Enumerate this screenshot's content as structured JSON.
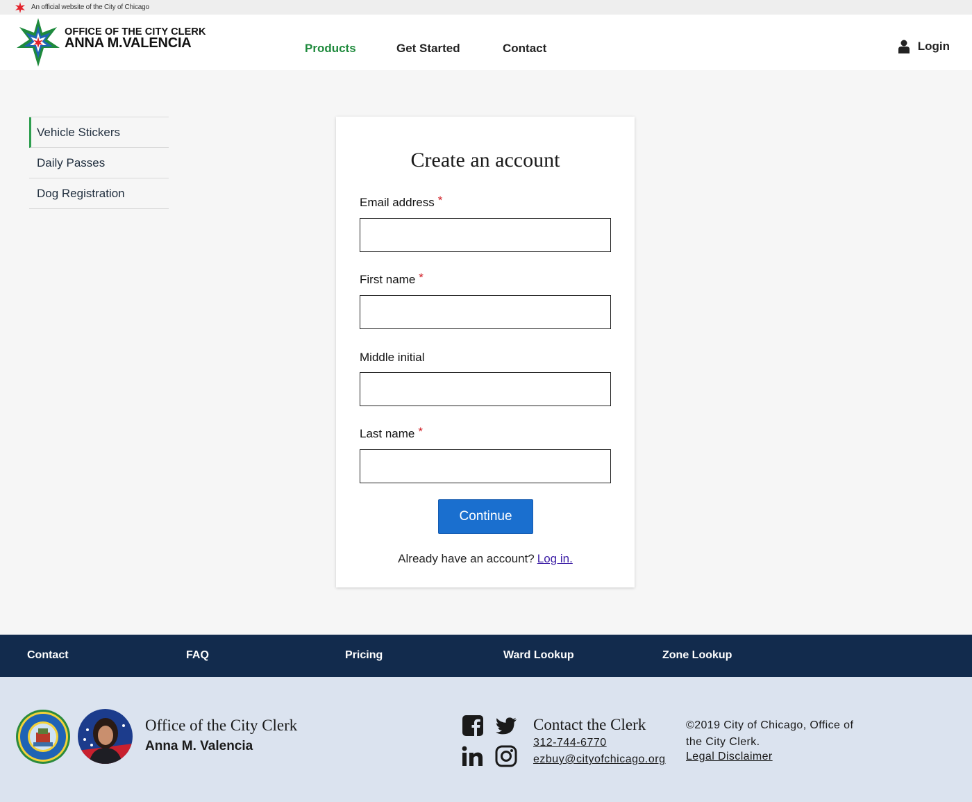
{
  "official_bar": {
    "text": "An official website of the City of Chicago"
  },
  "header": {
    "logo_line1": "OFFICE OF THE CITY CLERK",
    "logo_line2": "ANNA M.VALENCIA",
    "nav": [
      "Products",
      "Get Started",
      "Contact"
    ],
    "login_label": "Login"
  },
  "sidebar": {
    "items": [
      {
        "label": "Vehicle Stickers",
        "active": true
      },
      {
        "label": "Daily Passes",
        "active": false
      },
      {
        "label": "Dog Registration",
        "active": false
      }
    ]
  },
  "form": {
    "title": "Create an account",
    "required_mark": "*",
    "fields": [
      {
        "label": "Email address",
        "required": true,
        "value": ""
      },
      {
        "label": "First name",
        "required": true,
        "value": ""
      },
      {
        "label": "Middle initial",
        "required": false,
        "value": ""
      },
      {
        "label": "Last name",
        "required": true,
        "value": ""
      }
    ],
    "continue_label": "Continue",
    "already_text": "Already have an account?",
    "login_link": "Log in."
  },
  "footer_nav": [
    "Contact",
    "FAQ",
    "Pricing",
    "Ward Lookup",
    "Zone Lookup"
  ],
  "footer": {
    "office": "Office of the City Clerk",
    "name": "Anna M. Valencia",
    "contact_title": "Contact the Clerk",
    "phone": "312-744-6770",
    "email": "ezbuy@cityofchicago.org",
    "copyright": "©2019 City of Chicago, Office of the City Clerk.",
    "legal": "Legal Disclaimer",
    "seal_text_top": "CITY OF CHICAGO",
    "seal_text_bottom": "INCORPORATED 4th MARCH 1837"
  },
  "icons": {
    "official": "chicago-star-icon",
    "login": "user-icon",
    "social": [
      "facebook-icon",
      "twitter-icon",
      "linkedin-icon",
      "instagram-icon"
    ]
  },
  "colors": {
    "nav_active": "#1e8a3c",
    "sidebar_active": "#2e9e4f",
    "button": "#1a6fcf",
    "footer_nav_bg": "#122b4d",
    "footer_bg": "#dbe3ef",
    "required": "#d01f26",
    "link": "#3d1fa6"
  }
}
